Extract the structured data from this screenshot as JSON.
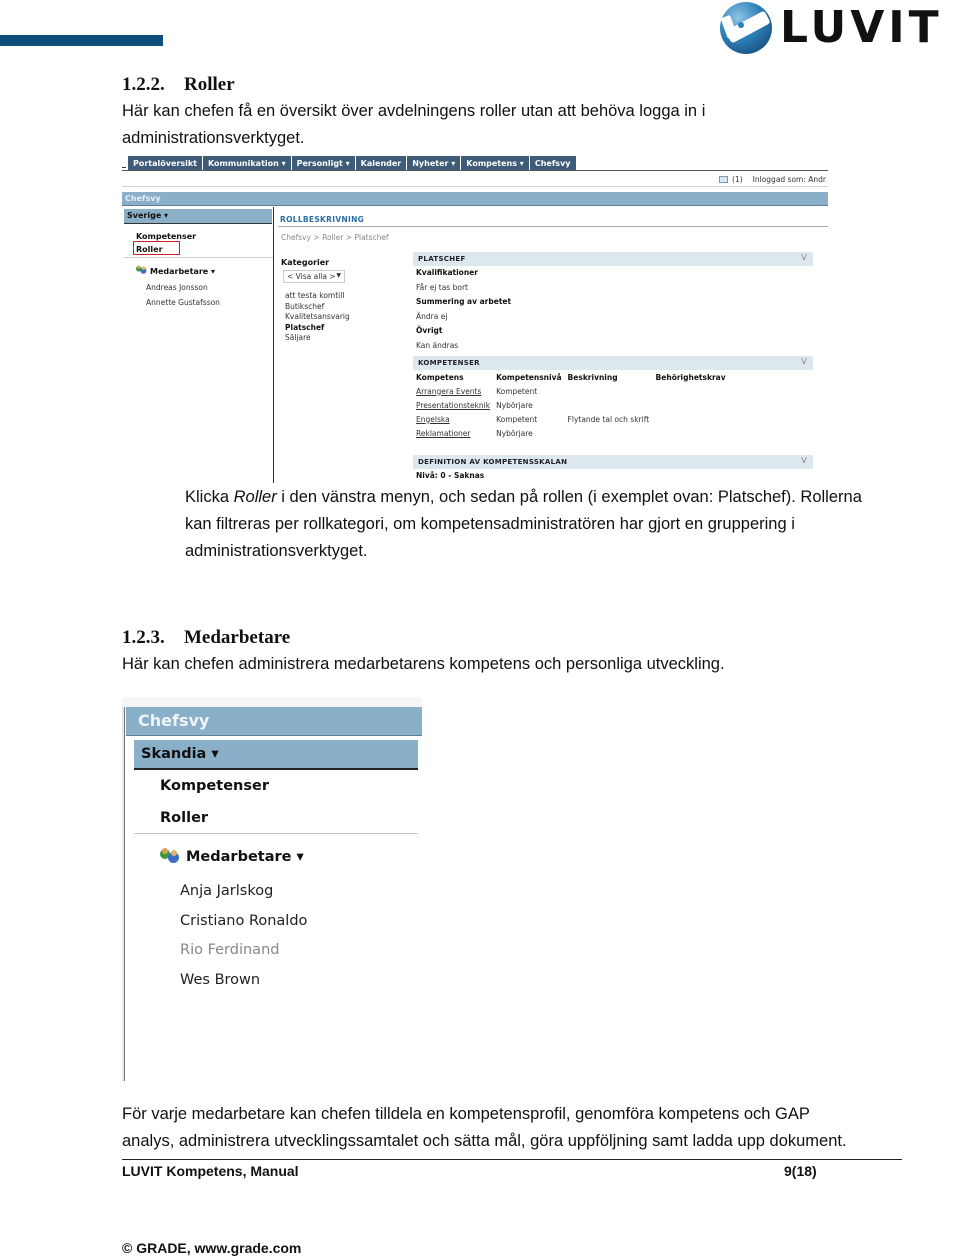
{
  "header": {
    "logo_text": "LUVIT"
  },
  "section_roller": {
    "number": "1.2.2.",
    "title": "Roller",
    "intro_line1": "Här kan chefen få en översikt över avdelningens roller utan att behöva logga in i",
    "intro_line2": "administrationsverktyget.",
    "instructions_pre": "Klicka ",
    "instructions_em": "Roller",
    "instructions_post": " i den vänstra menyn, och sedan på rollen (i exemplet ovan: Platschef). Rollerna",
    "instructions_line2": "kan filtreras per rollkategori, om kompetensadministratören har gjort en gruppering i",
    "instructions_line3": "administrationsverktyget."
  },
  "screenshot1": {
    "nav_tabs": [
      "Portalöversikt",
      "Kommunikation ▾",
      "Personligt ▾",
      "Kalender",
      "Nyheter ▾",
      "Kompetens ▾",
      "Chefsvy"
    ],
    "message_count": "(1)",
    "logged_in": "Inloggad som: Andr",
    "chefsvy_label": "Chefsvy",
    "org_group": "Sverige ▾",
    "menu_links": [
      "Kompetenser",
      "Roller"
    ],
    "employees_label": "Medarbetare ▾",
    "employees": [
      "Andreas Jonsson",
      "Annette Gustafsson"
    ],
    "rollbeskrivning_title": "ROLLBESKRIVNING",
    "breadcrumb": "Chefsvy > Roller > Platschef",
    "categories_title": "Kategorier",
    "category_select": "< Visa alla >",
    "categories": [
      "att testa komtill",
      "Butikschef",
      "Kvalitetsansvarig",
      "Platschef",
      "Säljare"
    ],
    "active_category": "Platschef",
    "role_panel": {
      "title": "PLATSCHEF",
      "collapse": "V",
      "fields": [
        {
          "label": "Kvalifikationer",
          "value": "Får ej tas bort"
        },
        {
          "label": "Summering av arbetet",
          "value": "Ändra ej"
        },
        {
          "label": "Övrigt",
          "value": "Kan ändras"
        }
      ]
    },
    "competence_panel": {
      "title": "KOMPETENSER",
      "collapse": "V",
      "columns": [
        "Kompetens",
        "Kompetensnivå",
        "Beskrivning",
        "Behörighetskrav"
      ],
      "rows": [
        [
          "Arrangera Events",
          "Kompetent",
          "",
          ""
        ],
        [
          "Presentationsteknik",
          "Nybörjare",
          "",
          ""
        ],
        [
          "Engelska",
          "Kompetent",
          "Flytande tal och skrift",
          ""
        ],
        [
          "Reklamationer",
          "Nybörjare",
          "",
          ""
        ]
      ]
    },
    "scale_panel": {
      "title": "DEFINITION AV KOMPETENSSKALAN",
      "collapse": "V",
      "first_level": "Nivå: 0 - Saknas"
    }
  },
  "section_medarbetare": {
    "number": "1.2.3.",
    "title": "Medarbetare",
    "intro": "Här kan chefen administrera medarbetarens kompetens och personliga utveckling.",
    "outro_line1": "För varje medarbetare kan chefen tilldela en kompetensprofil, genomföra kompetens och GAP",
    "outro_line2": "analys, administrera utvecklingssamtalet och sätta mål, göra uppföljning samt ladda upp dokument."
  },
  "screenshot2": {
    "chefsvy_label": "Chefsvy",
    "org_group": "Skandia ▾",
    "menu_links": [
      "Kompetenser",
      "Roller"
    ],
    "employees_label": "Medarbetare ▾",
    "employees": [
      {
        "name": "Anja Jarlskog",
        "inactive": false
      },
      {
        "name": "Cristiano Ronaldo",
        "inactive": false
      },
      {
        "name": "Rio Ferdinand",
        "inactive": true
      },
      {
        "name": "Wes Brown",
        "inactive": false
      }
    ]
  },
  "footer": {
    "doc_title": "LUVIT Kompetens, Manual",
    "page": "9(18)",
    "copyright": "© GRADE, www.grade.com"
  }
}
